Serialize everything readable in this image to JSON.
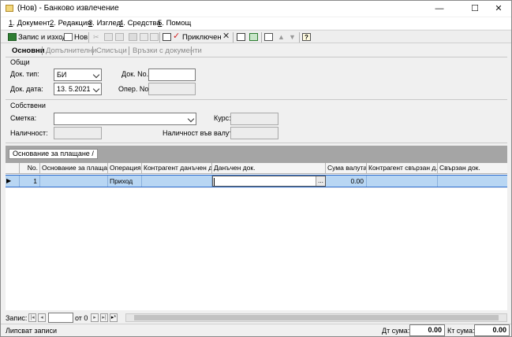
{
  "window": {
    "title": "(Нов) - Банково извлечение",
    "controls": [
      "—",
      "☐",
      "✕"
    ]
  },
  "menu": [
    {
      "key": "1",
      "label": ". Документ"
    },
    {
      "key": "2",
      "label": ". Редакция"
    },
    {
      "key": "3",
      "label": ". Изглед"
    },
    {
      "key": "4",
      "label": ". Средства"
    },
    {
      "key": "5",
      "label": ". Помощ"
    }
  ],
  "toolbar": {
    "save_exit_label": "Запис и изход",
    "new_label": "Нов",
    "finished_label": "Приключен",
    "help_glyph": "?"
  },
  "tabs": [
    "Основни",
    "Допълнителни",
    "Списъци",
    "Връзки с документи"
  ],
  "general": {
    "group_title": "Общи",
    "doc_type_label": "Док. тип:",
    "doc_type_value": "БИ",
    "doc_no_label": "Док. No.",
    "doc_no_value": "",
    "doc_date_label": "Док. дата:",
    "doc_date_value": "13.  5.2021",
    "oper_no_label": "Опер. No.",
    "oper_no_value": ""
  },
  "own": {
    "group_title": "Собствени",
    "account_label": "Сметка:",
    "account_value": "",
    "rate_label": "Курс:",
    "rate_value": "",
    "availability_label": "Наличност:",
    "availability_value": "",
    "currency_availability_label": "Наличност във валута:",
    "currency_availability_value": ""
  },
  "grid": {
    "group_by_chip": "Основание за плащане /",
    "columns": [
      "No.",
      "Основание за плащане",
      "Операция",
      "Контрагент данъчен д...",
      "Данъчен док.",
      "Сума валута",
      "Контрагент свързан д...",
      "Свързан док."
    ],
    "rows": [
      {
        "indicator": "▶",
        "no": "1",
        "basis": "",
        "operation": "Приход",
        "counterparty": "",
        "tax_doc": "",
        "ellipsis": "...",
        "amount_currency": "0.00",
        "counterparty_related": "",
        "related_doc": ""
      }
    ]
  },
  "navigator": {
    "record_label": "Запис:",
    "record_value": "",
    "of_label": "от 0"
  },
  "status": {
    "message": "Липсват записи",
    "debit_label": "Дт сума:",
    "debit_value": "0.00",
    "credit_label": "Кт сума:",
    "credit_value": "0.00"
  }
}
